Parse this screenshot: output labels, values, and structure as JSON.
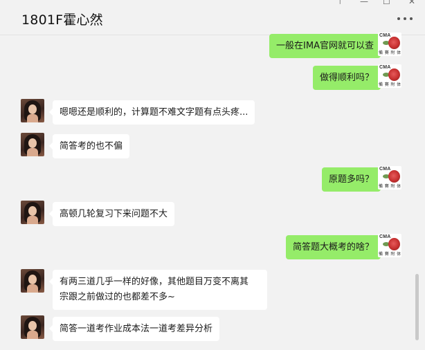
{
  "window": {
    "title": "1801F霍心然",
    "controls": {
      "pin": "⊤",
      "minimize": "—",
      "maximize": "☐",
      "close": "✕"
    }
  },
  "messages": [
    {
      "side": "right",
      "text": "一般在IMA官网就可以查"
    },
    {
      "side": "right",
      "text": "做得顺利吗？"
    },
    {
      "side": "left",
      "text": "嗯嗯还是顺利的，计算题不难文字题有点头疼..."
    },
    {
      "side": "left",
      "text": "简答考的也不偏"
    },
    {
      "side": "right",
      "text": "原题多吗？"
    },
    {
      "side": "left",
      "text": "高顿几轮复习下来问题不大"
    },
    {
      "side": "right",
      "text": "简答题大概考的啥？"
    },
    {
      "side": "left",
      "lines": [
        "有两三道几乎一样的好像，其他题目万变不离其",
        "宗跟之前做过的也都差不多~"
      ]
    },
    {
      "side": "left",
      "text": "简答一道考作业成本法一道考差异分析"
    }
  ],
  "avatars": {
    "self": {
      "label": "CMA",
      "sub": "備 賽 附 体"
    }
  },
  "colors": {
    "background": "#f2f2f2",
    "bubble_self": "#95ec69",
    "bubble_other": "#ffffff"
  }
}
